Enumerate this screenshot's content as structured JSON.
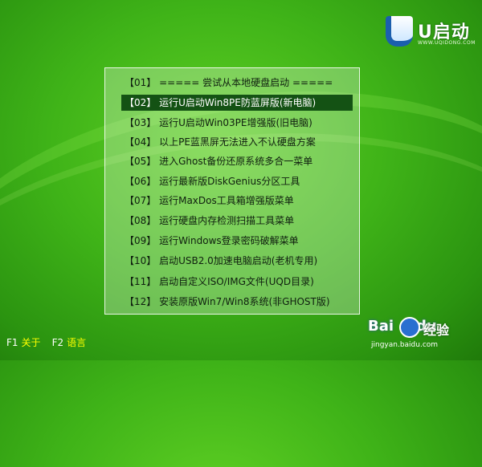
{
  "logo": {
    "brand": "U启动",
    "url": "WWW.UQIDONG.COM"
  },
  "menu": {
    "items": [
      "【01】 ===== 尝试从本地硬盘启动 =====",
      "【02】 运行U启动Win8PE防蓝屏版(新电脑)",
      "【03】 运行U启动Win03PE增强版(旧电脑)",
      "【04】 以上PE蓝黑屏无法进入不认硬盘方案",
      "【05】 进入Ghost备份还原系统多合一菜单",
      "【06】 运行最新版DiskGenius分区工具",
      "【07】 运行MaxDos工具箱增强版菜单",
      "【08】 运行硬盘内存检测扫描工具菜单",
      "【09】 运行Windows登录密码破解菜单",
      "【10】 启动USB2.0加速电脑启动(老机专用)",
      "【11】 启动自定义ISO/IMG文件(UQD目录)",
      "【12】 安装原版Win7/Win8系统(非GHOST版)"
    ],
    "selected_index": 1
  },
  "footer": {
    "f1_key": "F1",
    "f1_label": "关于",
    "f2_key": "F2",
    "f2_label": "语言"
  },
  "watermark": {
    "baidu": "Bai",
    "baidu_suffix": "du",
    "jingyan": "经验",
    "url": "jingyan.baidu.com"
  },
  "colors": {
    "background": "#3fb318",
    "selected_bg": "#145214",
    "footer_label": "#ffff00"
  }
}
